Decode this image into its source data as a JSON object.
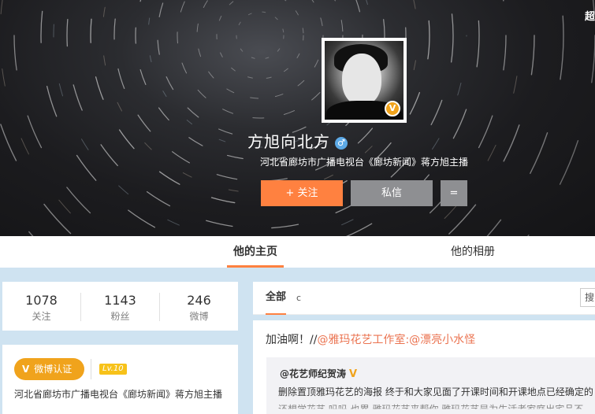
{
  "header": {
    "corner_text": "超"
  },
  "profile": {
    "name": "方旭向北方",
    "gender_symbol": "♂",
    "verified_mark": "V",
    "bio": "河北省廊坊市广播电视台《廊坊新闻》蒋方旭主播"
  },
  "actions": {
    "follow": "+ 关注",
    "message": "私信",
    "more": "="
  },
  "tabs": [
    {
      "label": "他的主页"
    },
    {
      "label": "他的相册"
    }
  ],
  "stats": [
    {
      "num": "1078",
      "label": "关注"
    },
    {
      "num": "1143",
      "label": "粉丝"
    },
    {
      "num": "246",
      "label": "微博"
    }
  ],
  "verify": {
    "mark": "V",
    "label": "微博认证",
    "level": "Lv.10",
    "desc": "河北省廊坊市广播电视台《廊坊新闻》蒋方旭主播"
  },
  "feed": {
    "tab_all": "全部",
    "tab_c": "c",
    "search_text": "搜",
    "post": {
      "prefix": "加油啊！//",
      "mention1": "@雅玛花艺工作室",
      "colon": ":",
      "mention2": "@漂亮小水怪"
    },
    "repost": {
      "author": "@花艺师纪贺涛",
      "verified_mark": "V",
      "text": "删除置顶雅玛花艺的海报  终于和大家见面了开课时间和开课地点已经确定的",
      "more": "还想学花艺 吗吗  也累 雅玛花艺来帮你  雅玛花艺是为生活者家庭出宅品不"
    }
  },
  "colors": {
    "accent": "#ff8140",
    "verified": "#f0a31c",
    "mention": "#eb7350",
    "page_bg": "#cfe3f1"
  }
}
